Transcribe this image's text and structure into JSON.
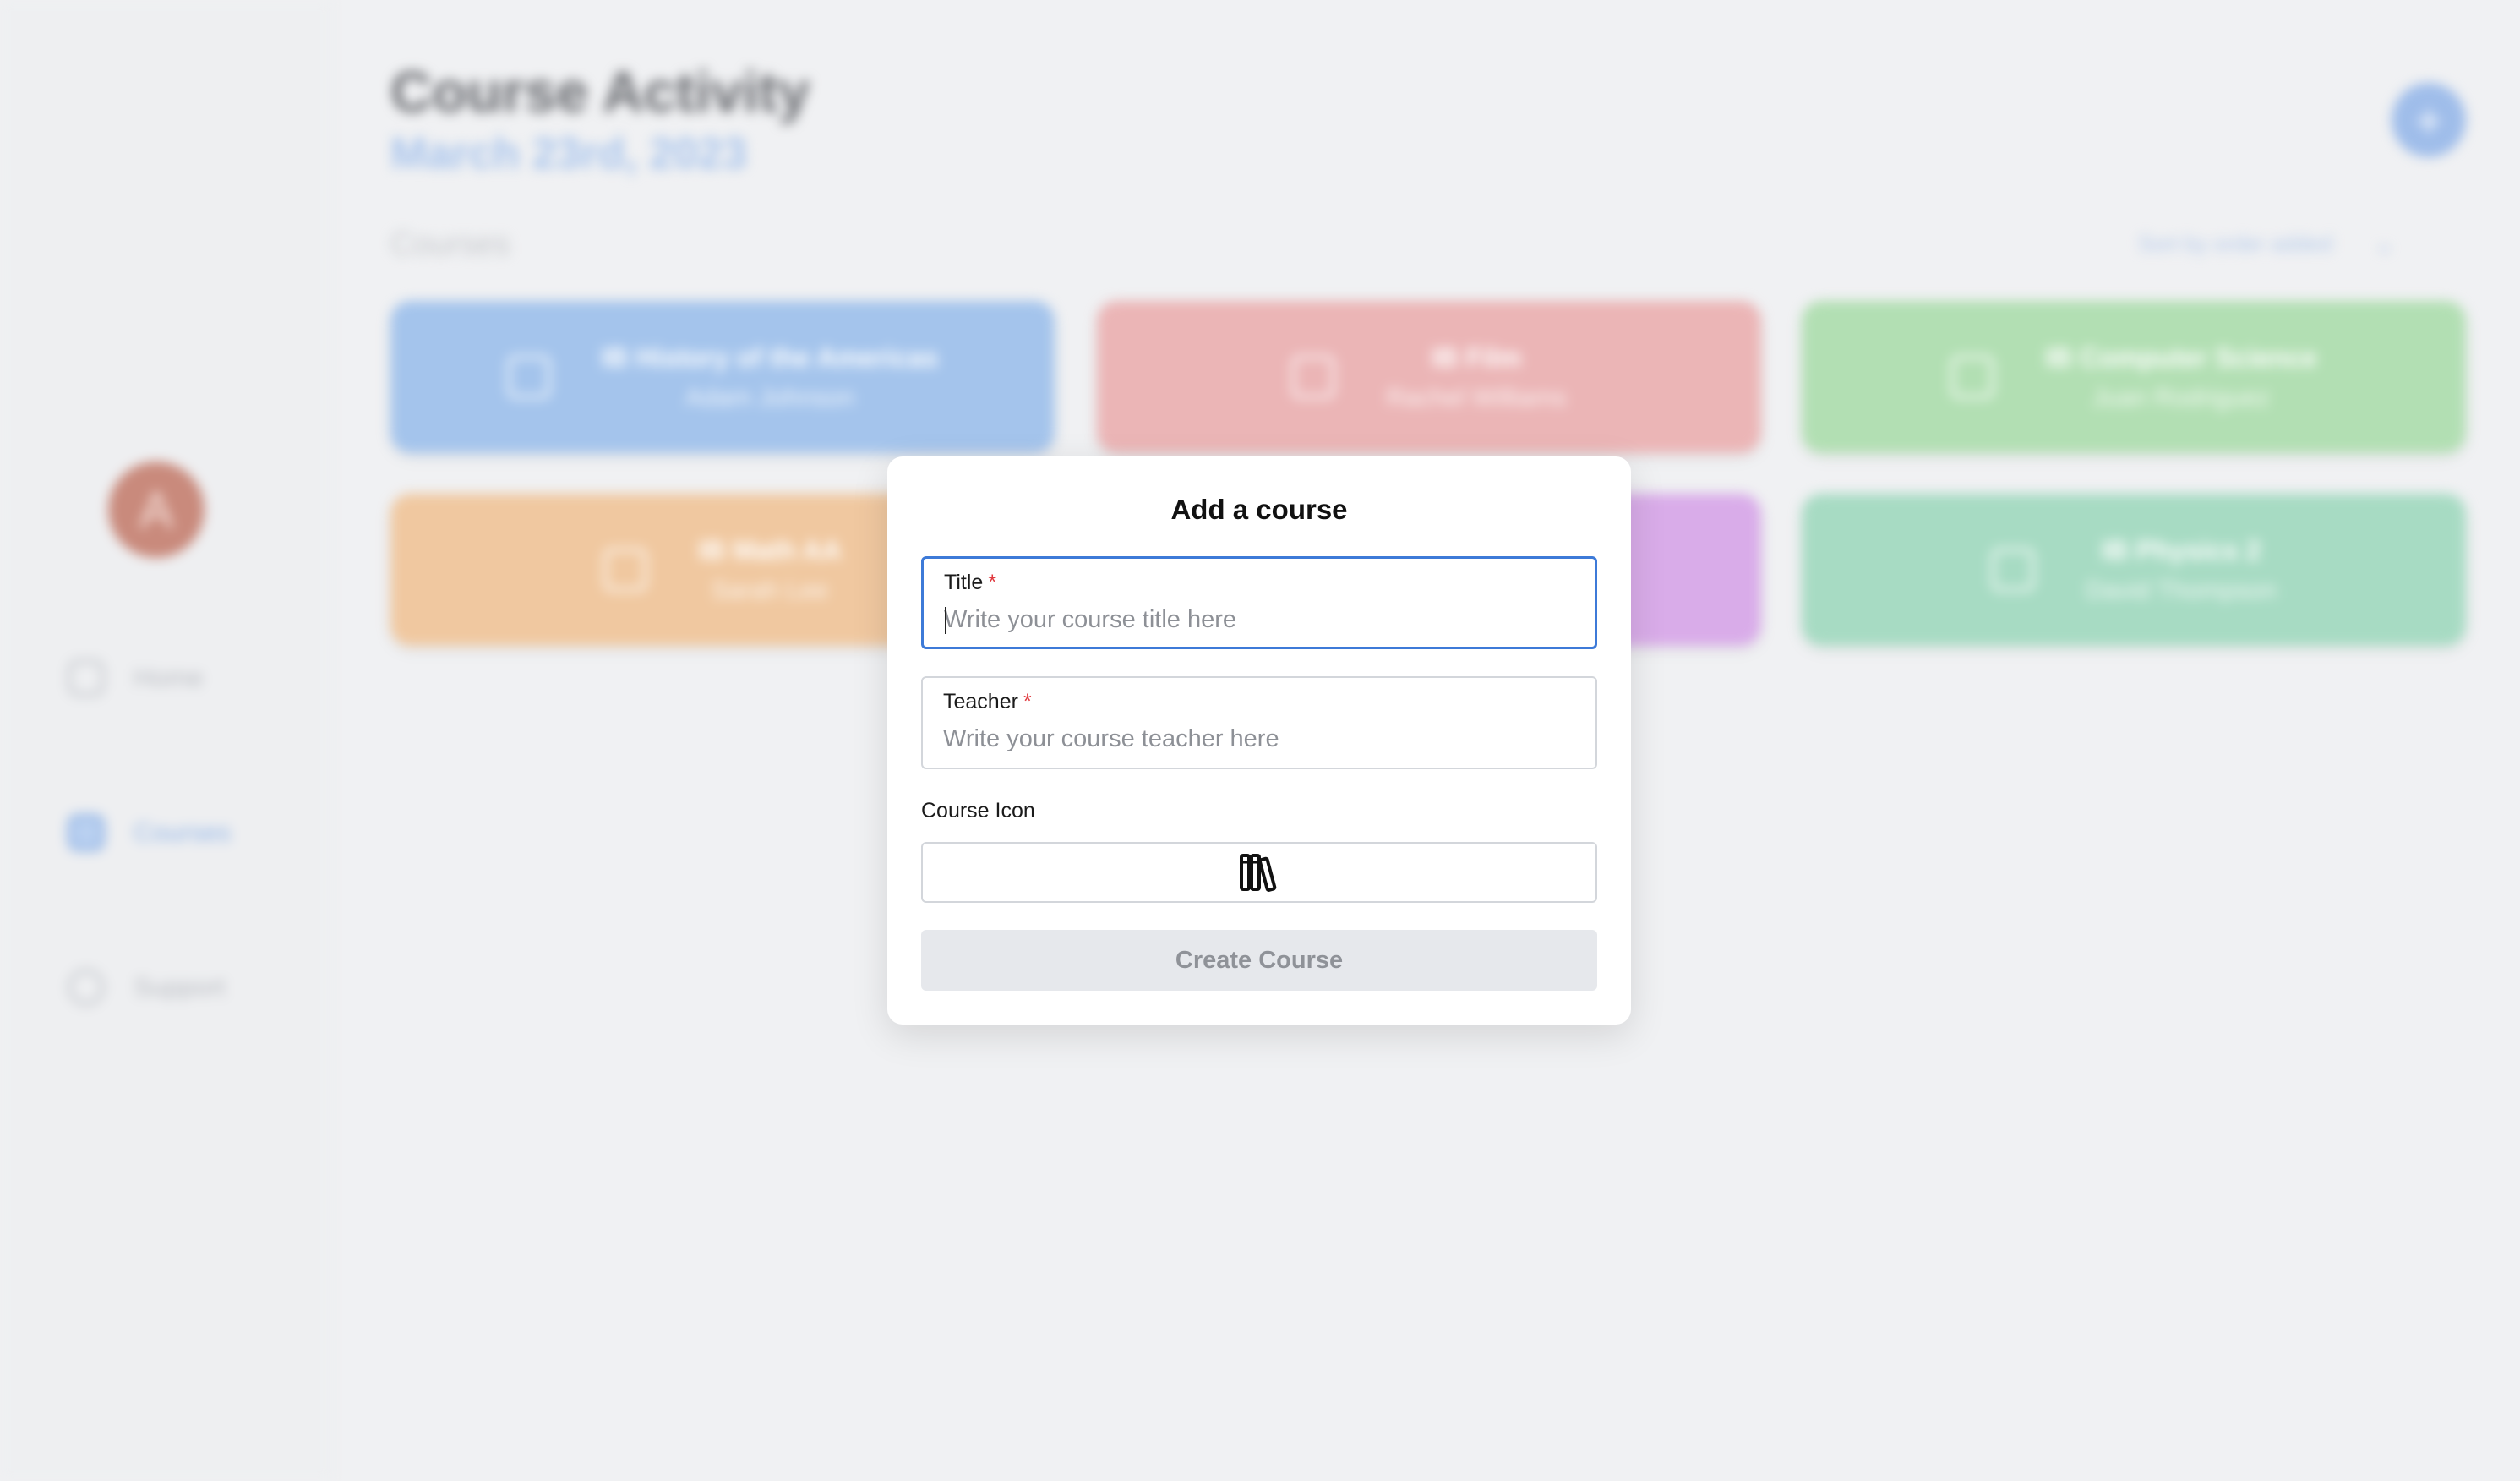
{
  "sidebar": {
    "avatar_initial": "A",
    "items": [
      {
        "label": "Home",
        "icon": "home-icon"
      },
      {
        "label": "Courses",
        "icon": "courses-icon"
      },
      {
        "label": "Support",
        "icon": "chat-icon"
      }
    ]
  },
  "header": {
    "title": "Course Activity",
    "date": "March 23rd, 2023",
    "add_label": "+"
  },
  "courses_section": {
    "label": "Courses",
    "sort_label": "Sort by order added",
    "sort_chevron": "⌄"
  },
  "courses": [
    {
      "name": "IB History of the Americas",
      "teacher": "Adam Johnson",
      "color": "#a4c4ec",
      "icon": "image-icon"
    },
    {
      "name": "IB Film",
      "teacher": "Rachel Williams",
      "color": "#ebb5b6",
      "icon": "film-icon"
    },
    {
      "name": "IB Computer Science",
      "teacher": "Juan Rodriguez",
      "color": "#b2dfb3",
      "icon": "computer-icon"
    },
    {
      "name": "IB Math AA",
      "teacher": "Sarah Lee",
      "color": "#f0c8a0",
      "icon": "math-icon"
    },
    {
      "name": "",
      "teacher": "",
      "color": "#d9ace9",
      "icon": ""
    },
    {
      "name": "IB Physics 2",
      "teacher": "David Thompson",
      "color": "#a7dbc3",
      "icon": "calendar-icon"
    }
  ],
  "modal": {
    "title": "Add a course",
    "title_field": {
      "label": "Title",
      "required_mark": "*",
      "placeholder": "Write your course title here",
      "value": ""
    },
    "teacher_field": {
      "label": "Teacher",
      "required_mark": "*",
      "placeholder": "Write your course teacher here",
      "value": ""
    },
    "icon_label": "Course Icon",
    "selected_icon": "books-icon",
    "submit_label": "Create Course"
  }
}
